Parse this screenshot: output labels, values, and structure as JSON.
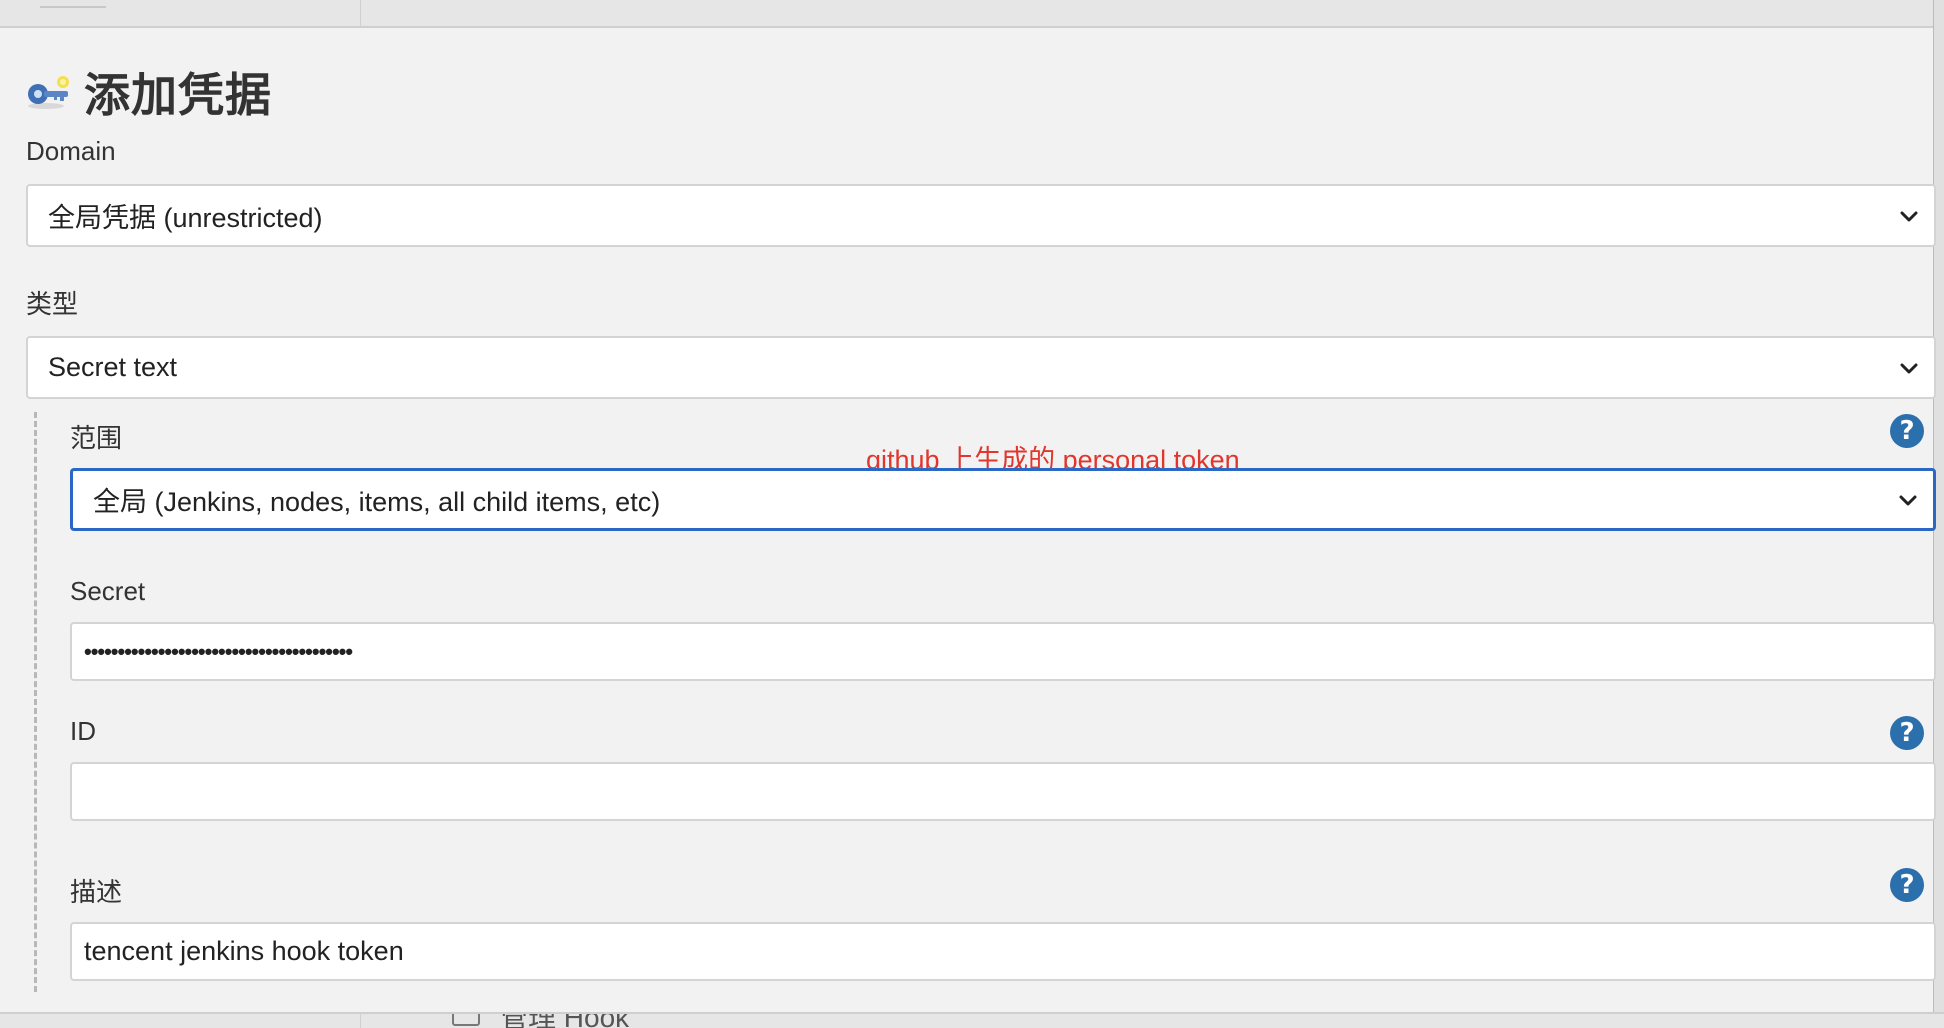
{
  "page": {
    "title": "添加凭据"
  },
  "domain": {
    "label": "Domain",
    "selected": "全局凭据 (unrestricted)"
  },
  "kind": {
    "label": "类型",
    "selected": "Secret text"
  },
  "scope": {
    "label": "范围",
    "selected": "全局 (Jenkins, nodes, items, all child items, etc)"
  },
  "annotation": {
    "text": "github 上生成的 personal token",
    "color": "#e0362d"
  },
  "secret": {
    "label": "Secret",
    "value": "••••••••••••••••••••••••••••••••••••••••"
  },
  "id_field": {
    "label": "ID",
    "value": ""
  },
  "description": {
    "label": "描述",
    "value": "tencent jenkins hook token"
  },
  "help": {
    "glyph": "?"
  },
  "partially_visible": {
    "label": "管理 Hook"
  },
  "colors": {
    "focus_border": "#2b68c6",
    "help_icon": "#2b6fad",
    "background": "#f2f2f2"
  }
}
